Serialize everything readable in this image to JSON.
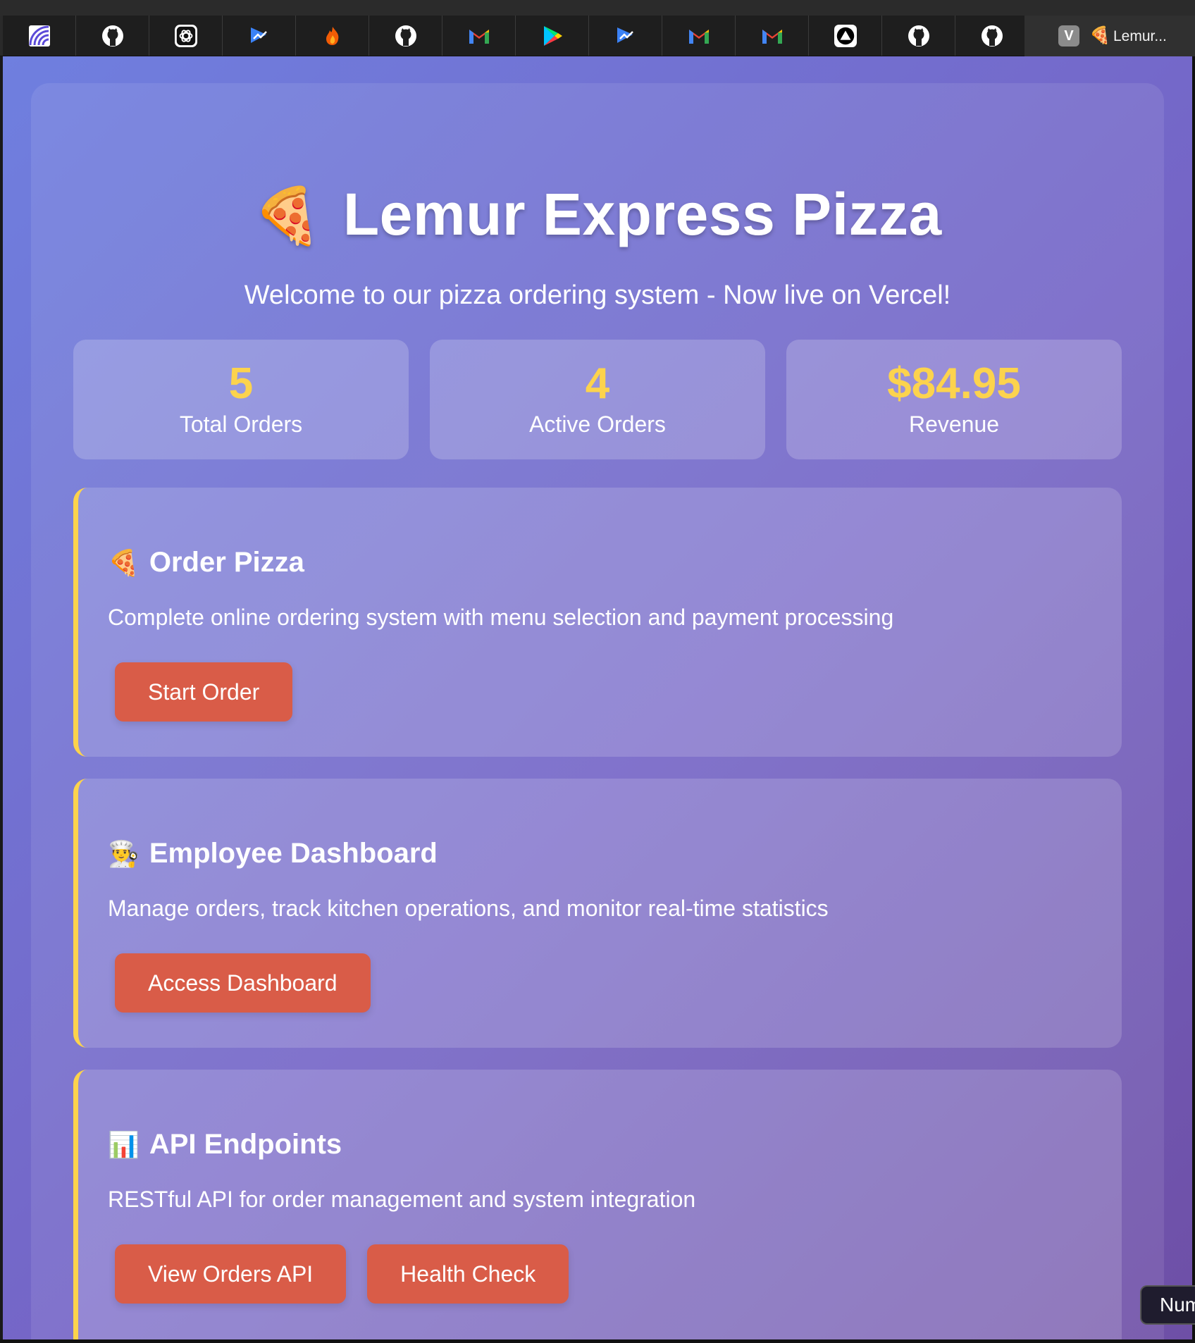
{
  "browser": {
    "pinned_tabs": [
      {
        "name": "linear-tab",
        "icon": "linear-icon"
      },
      {
        "name": "github-tab-1",
        "icon": "github-icon"
      },
      {
        "name": "chatgpt-tab",
        "icon": "chatgpt-icon"
      },
      {
        "name": "zoom-tab-1",
        "icon": "zoom-icon"
      },
      {
        "name": "flame-tab",
        "icon": "flame-icon"
      },
      {
        "name": "github-tab-2",
        "icon": "github-icon"
      },
      {
        "name": "gmail-tab-1",
        "icon": "gmail-icon"
      },
      {
        "name": "play-tab",
        "icon": "play-store-icon"
      },
      {
        "name": "zoom-tab-2",
        "icon": "zoom-icon"
      },
      {
        "name": "gmail-tab-2",
        "icon": "gmail-icon"
      },
      {
        "name": "gmail-tab-3",
        "icon": "gmail-icon"
      },
      {
        "name": "vercel-tab",
        "icon": "vercel-icon"
      },
      {
        "name": "github-tab-3",
        "icon": "github-icon"
      },
      {
        "name": "github-tab-4",
        "icon": "github-icon"
      }
    ],
    "active_tab": {
      "badge": "V",
      "emoji": "🍕",
      "title": "Lemur..."
    }
  },
  "page": {
    "title_emoji": "🍕",
    "title": "Lemur Express Pizza",
    "subtitle": "Welcome to our pizza ordering system - Now live on Vercel!"
  },
  "stats": [
    {
      "value": "5",
      "label": "Total Orders"
    },
    {
      "value": "4",
      "label": "Active Orders"
    },
    {
      "value": "$84.95",
      "label": "Revenue"
    }
  ],
  "features": {
    "order": {
      "emoji": "🍕",
      "title": "Order Pizza",
      "description": "Complete online ordering system with menu selection and payment processing",
      "button": "Start Order"
    },
    "employee": {
      "emoji": "👨‍🍳",
      "title": "Employee Dashboard",
      "description": "Manage orders, track kitchen operations, and monitor real-time statistics",
      "button": "Access Dashboard"
    },
    "api": {
      "emoji": "📊",
      "title": "API Endpoints",
      "description": "RESTful API for order management and system integration",
      "buttons": [
        "View Orders API",
        "Health Check"
      ]
    }
  },
  "overlay": {
    "tooltip": "Num"
  },
  "colors": {
    "accent_yellow": "#fcd34d",
    "button_red": "#d95c48",
    "gradient_start": "#6f7fdf",
    "gradient_end": "#6e4fa6"
  }
}
